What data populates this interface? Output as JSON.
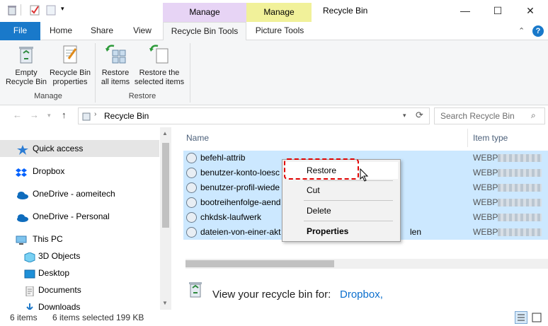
{
  "window": {
    "title": "Recycle Bin"
  },
  "context_tabs": {
    "manage_recycle": "Manage",
    "manage_picture": "Manage"
  },
  "tabs": {
    "file": "File",
    "home": "Home",
    "share": "Share",
    "view": "View",
    "recycle_bin_tools": "Recycle Bin Tools",
    "picture_tools": "Picture Tools"
  },
  "ribbon": {
    "empty_recycle_bin": [
      "Empty",
      "Recycle Bin"
    ],
    "recycle_bin_properties": [
      "Recycle Bin",
      "properties"
    ],
    "restore_all": [
      "Restore",
      "all items"
    ],
    "restore_selected": [
      "Restore the",
      "selected items"
    ],
    "group_manage": "Manage",
    "group_restore": "Restore"
  },
  "address": {
    "location": "Recycle Bin",
    "search_placeholder": "Search Recycle Bin"
  },
  "nav": [
    {
      "label": "Quick access",
      "icon": "star-icon",
      "selected": true
    },
    {
      "label": "Dropbox",
      "icon": "dropbox-icon"
    },
    {
      "label": "OneDrive - aomeitech",
      "icon": "onedrive-cloud-icon"
    },
    {
      "label": "OneDrive - Personal",
      "icon": "onedrive-cloud-icon"
    },
    {
      "label": "This PC",
      "icon": "computer-icon"
    },
    {
      "label": "3D Objects",
      "icon": "3d-objects-icon"
    },
    {
      "label": "Desktop",
      "icon": "desktop-icon"
    },
    {
      "label": "Documents",
      "icon": "documents-icon"
    },
    {
      "label": "Downloads",
      "icon": "downloads-icon"
    }
  ],
  "columns": {
    "name": "Name",
    "item_type": "Item type"
  },
  "files": [
    {
      "name": "befehl-attrib",
      "type": "WEBP"
    },
    {
      "name": "benutzer-konto-loesc",
      "type": "WEBP"
    },
    {
      "name": "benutzer-profil-wiede",
      "type": "WEBP"
    },
    {
      "name": "bootreihenfolge-aend",
      "type": "WEBP"
    },
    {
      "name": "chkdsk-laufwerk",
      "type": "WEBP"
    },
    {
      "name": "dateien-von-einer-akt",
      "suffix": "len",
      "type": "WEBP"
    }
  ],
  "context_menu": {
    "restore": "Restore",
    "cut": "Cut",
    "delete": "Delete",
    "properties": "Properties"
  },
  "banner": {
    "text": "View your recycle bin for:",
    "link": "Dropbox,"
  },
  "status": {
    "count": "6 items",
    "selected": "6 items selected",
    "size": "199 KB"
  },
  "colors": {
    "accent": "#1979ca",
    "selection": "#cce8ff",
    "manage_recycle": "#e7d4f5",
    "manage_picture": "#f1f19a",
    "highlight": "#e00000"
  }
}
